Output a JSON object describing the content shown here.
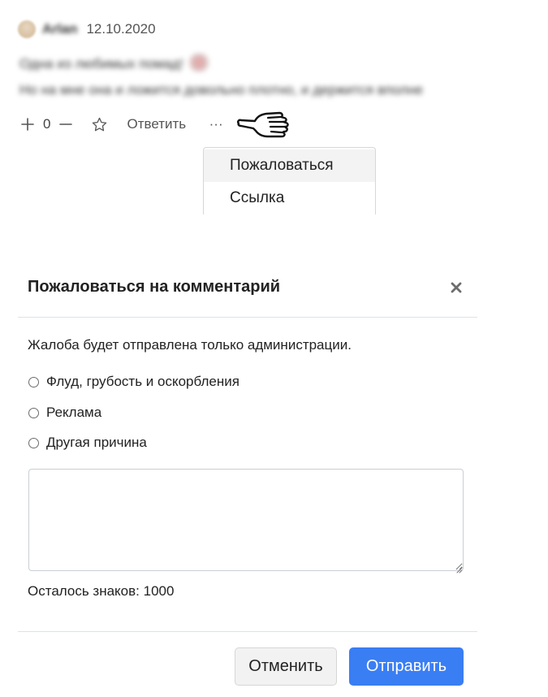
{
  "comment": {
    "author": "Arlan",
    "date": "12.10.2020",
    "text_line1": "Одна из любимых помад!",
    "text_line2": "Но на мне она и ложится довольно плотно, и держится вполне",
    "score": "0",
    "reply_label": "Ответить",
    "more_label": "···"
  },
  "dropdown": {
    "items": [
      "Пожаловаться",
      "Ссылка"
    ]
  },
  "modal": {
    "title": "Пожаловаться на комментарий",
    "close_label": "×",
    "note": "Жалоба будет отправлена только администрации.",
    "options": [
      "Флуд, грубость и оскорбления",
      "Реклама",
      "Другая причина"
    ],
    "textarea_value": "",
    "char_counter": "Осталось знаков: 1000",
    "cancel_label": "Отменить",
    "submit_label": "Отправить"
  },
  "colors": {
    "accent": "#3a7ef3",
    "text": "#212529",
    "muted": "#555555",
    "divider": "#dee2e6"
  },
  "icons": {
    "vote_up": "plus-icon",
    "vote_down": "minus-icon",
    "favorite": "star-icon",
    "cursor": "hand-cursor-icon",
    "close": "close-icon"
  }
}
